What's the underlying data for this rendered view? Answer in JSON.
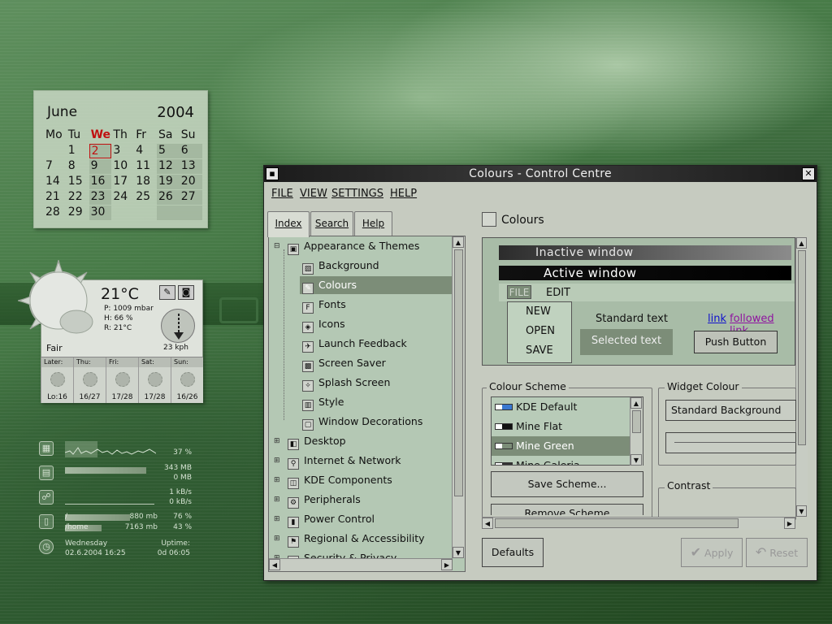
{
  "calendar": {
    "month": "June",
    "year": "2004",
    "weekdays": [
      "Mo",
      "Tu",
      "We",
      "Th",
      "Fr",
      "Sa",
      "Su"
    ],
    "days": [
      "",
      "1",
      "2",
      "3",
      "4",
      "5",
      "6",
      "7",
      "8",
      "9",
      "10",
      "11",
      "12",
      "13",
      "14",
      "15",
      "16",
      "17",
      "18",
      "19",
      "20",
      "21",
      "22",
      "23",
      "24",
      "25",
      "26",
      "27",
      "28",
      "29",
      "30",
      "",
      "",
      "",
      "",
      ""
    ],
    "today": "2"
  },
  "weather": {
    "temperature": "21°C",
    "pressure": "P: 1009 mbar",
    "humidity": "H: 66 %",
    "real": "R: 21°C",
    "wind": "23 kph",
    "condition": "Fair",
    "forecast": [
      {
        "day": "Later:",
        "temp": "Lo:16"
      },
      {
        "day": "Thu:",
        "temp": "16/27"
      },
      {
        "day": "Fri:",
        "temp": "17/28"
      },
      {
        "day": "Sat:",
        "temp": "17/28"
      },
      {
        "day": "Sun:",
        "temp": "16/26"
      }
    ]
  },
  "sysmon": {
    "cpu": "37 %",
    "mem1": "343 MB",
    "mem2": "0 MB",
    "net1": "1 kB/s",
    "net2": "0 kB/s",
    "disk1_label": "/",
    "disk1_size": "880 mb",
    "disk1_pct": "76 %",
    "disk1_fill": 0.76,
    "disk2_label": "/home",
    "disk2_size": "7163 mb",
    "disk2_pct": "43 %",
    "disk2_fill": 0.43,
    "date_day": "Wednesday",
    "date": "02.6.2004 16:25",
    "uptime_label": "Uptime:",
    "uptime": "0d 06:05"
  },
  "window": {
    "title": "Colours - Control Centre",
    "menu": [
      "FILE",
      "VIEW",
      "SETTINGS",
      "HELP"
    ],
    "tabs": [
      "Index",
      "Search",
      "Help"
    ],
    "tree": [
      {
        "label": "Appearance & Themes",
        "level": 0,
        "expander": "−"
      },
      {
        "label": "Background",
        "level": 1
      },
      {
        "label": "Colours",
        "level": 1,
        "selected": true
      },
      {
        "label": "Fonts",
        "level": 1
      },
      {
        "label": "Icons",
        "level": 1
      },
      {
        "label": "Launch Feedback",
        "level": 1
      },
      {
        "label": "Screen Saver",
        "level": 1
      },
      {
        "label": "Splash Screen",
        "level": 1
      },
      {
        "label": "Style",
        "level": 1
      },
      {
        "label": "Window Decorations",
        "level": 1
      },
      {
        "label": "Desktop",
        "level": 0,
        "expander": "+"
      },
      {
        "label": "Internet & Network",
        "level": 0,
        "expander": "+"
      },
      {
        "label": "KDE Components",
        "level": 0,
        "expander": "+"
      },
      {
        "label": "Peripherals",
        "level": 0,
        "expander": "+"
      },
      {
        "label": "Power Control",
        "level": 0,
        "expander": "+"
      },
      {
        "label": "Regional & Accessibility",
        "level": 0,
        "expander": "+"
      },
      {
        "label": "Security & Privacy",
        "level": 0,
        "expander": "+"
      }
    ],
    "module_title": "Colours",
    "preview": {
      "inactive": "Inactive window",
      "active": "Active window",
      "file": "FILE",
      "edit": "EDIT",
      "menu_items": [
        "NEW",
        "OPEN",
        "SAVE"
      ],
      "standard_text": "Standard text",
      "selected_text": "Selected text",
      "link": "link",
      "followed_link": "followed link",
      "push_button": "Push Button"
    },
    "colour_scheme_label": "Colour Scheme",
    "schemes": [
      {
        "name": "KDE Default",
        "swatch": "#3a78d0"
      },
      {
        "name": "Mine Flat",
        "swatch": "#111111"
      },
      {
        "name": "Mine Green",
        "swatch": "#7c8d78",
        "selected": true
      },
      {
        "name": "Mine Galeria",
        "swatch": "#333333"
      }
    ],
    "save_scheme": "Save Scheme...",
    "remove_scheme": "Remove Scheme",
    "widget_colour_label": "Widget Colour",
    "widget_select": "Standard Background",
    "contrast_label": "Contrast",
    "defaults": "Defaults",
    "apply": "Apply",
    "reset": "Reset"
  }
}
